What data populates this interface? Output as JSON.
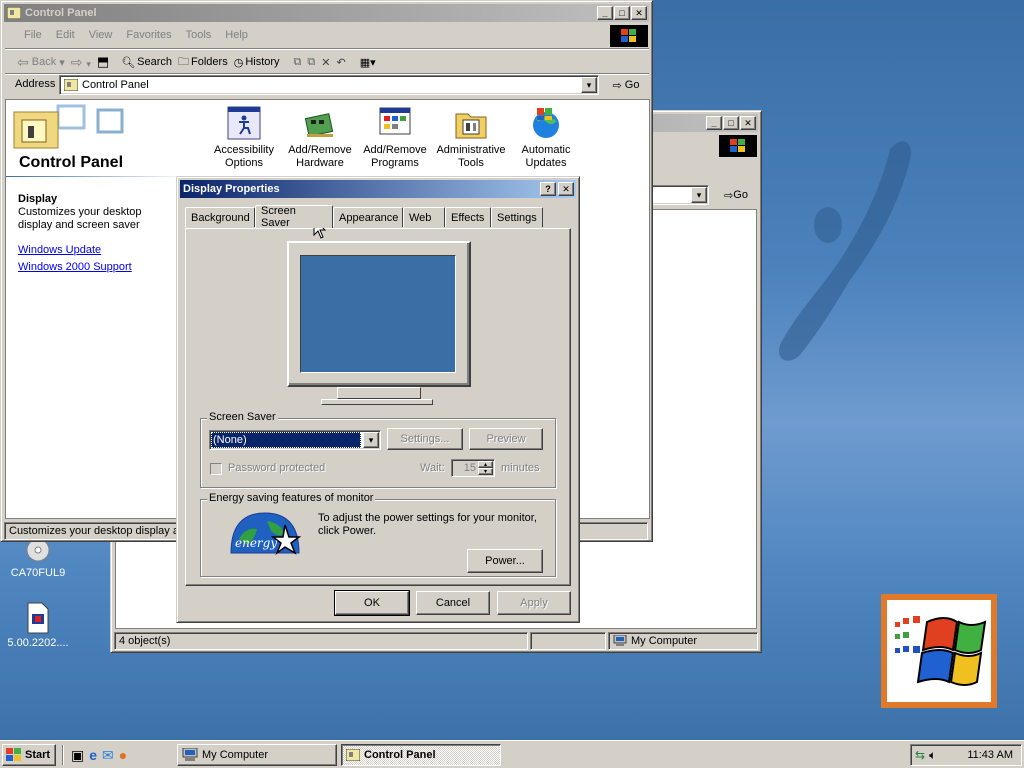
{
  "desktop": {
    "icons": [
      {
        "label": "CA70FUL9"
      },
      {
        "label": "5.00.2202...."
      }
    ]
  },
  "control_panel": {
    "title": "Control Panel",
    "menu": [
      "File",
      "Edit",
      "View",
      "Favorites",
      "Tools",
      "Help"
    ],
    "toolbar": {
      "back": "Back",
      "search": "Search",
      "folders": "Folders",
      "history": "History"
    },
    "address_label": "Address",
    "address_value": "Control Panel",
    "go": "Go",
    "heading": "Control Panel",
    "info_title": "Display",
    "info_desc": "Customizes your desktop display and screen saver",
    "links": [
      "Windows Update",
      "Windows 2000 Support"
    ],
    "items": [
      {
        "label": "Accessibility Options"
      },
      {
        "label": "Add/Remove Hardware"
      },
      {
        "label": "Add/Remove Programs"
      },
      {
        "label": "Administrative Tools"
      },
      {
        "label": "Automatic Updates"
      }
    ],
    "status": "Customizes your desktop display and screen saver"
  },
  "my_computer": {
    "go": "Go",
    "status_count": "4 object(s)",
    "status_zone": "My Computer"
  },
  "display_props": {
    "title": "Display Properties",
    "tabs": [
      "Background",
      "Screen Saver",
      "Appearance",
      "Web",
      "Effects",
      "Settings"
    ],
    "screensaver_group": "Screen Saver",
    "screensaver_value": "(None)",
    "settings_btn": "Settings...",
    "preview_btn": "Preview",
    "password_label": "Password protected",
    "wait_label": "Wait:",
    "wait_value": "15",
    "minutes_label": "minutes",
    "energy_group": "Energy saving features of monitor",
    "energy_text": "To adjust the power settings for your monitor, click Power.",
    "energy_logo": "energy",
    "power_btn": "Power...",
    "ok": "OK",
    "cancel": "Cancel",
    "apply": "Apply"
  },
  "taskbar": {
    "start": "Start",
    "tasks": [
      {
        "label": "My Computer",
        "active": false
      },
      {
        "label": "Control Panel",
        "active": true
      }
    ],
    "clock": "11:43 AM"
  },
  "colors": {
    "desktop": "#3a6ea5",
    "title_active": "#0a246a",
    "face": "#d4d0c8",
    "selection": "#0a246a"
  }
}
